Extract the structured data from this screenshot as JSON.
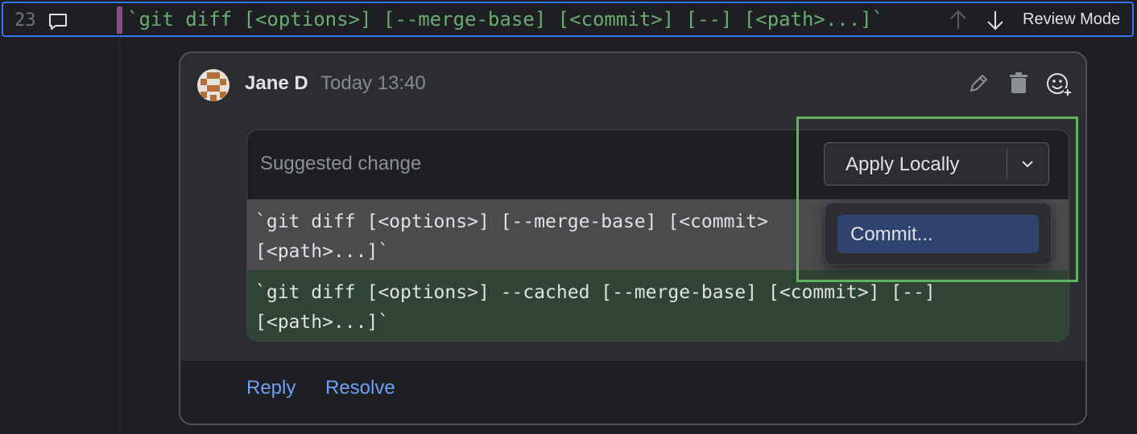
{
  "editor": {
    "line_number": "23",
    "code_line": "`git diff [<options>] [--merge-base] [<commit>] [--] [<path>...]`",
    "review_mode_label": "Review Mode"
  },
  "comment": {
    "author": "Jane D",
    "timestamp": "Today 13:40",
    "suggestion": {
      "label": "Suggested change",
      "old_line_1": "`git diff [<options>] [--merge-base] [<commit>",
      "old_line_2": "[<path>...]`",
      "new_line_1": "`git diff [<options>] --cached [--merge-base] [<commit>] [--]",
      "new_line_2": "[<path>...]`"
    },
    "apply_button_label": "Apply Locally",
    "dropdown_items": [
      "Commit..."
    ],
    "reply_label": "Reply",
    "resolve_label": "Resolve"
  },
  "colors": {
    "accent": "#3574f0",
    "code_green": "#6aab73",
    "link": "#6f9ff5",
    "highlight_border": "#5fb35f",
    "added_bg": "#2f4435",
    "removed_bg": "#4a4b4d",
    "selected_item_bg": "#2e436e"
  },
  "icons": [
    "comment-icon",
    "arrow-up-icon",
    "arrow-down-icon",
    "pencil-icon",
    "trash-icon",
    "add-reaction-icon",
    "chevron-down-icon"
  ]
}
